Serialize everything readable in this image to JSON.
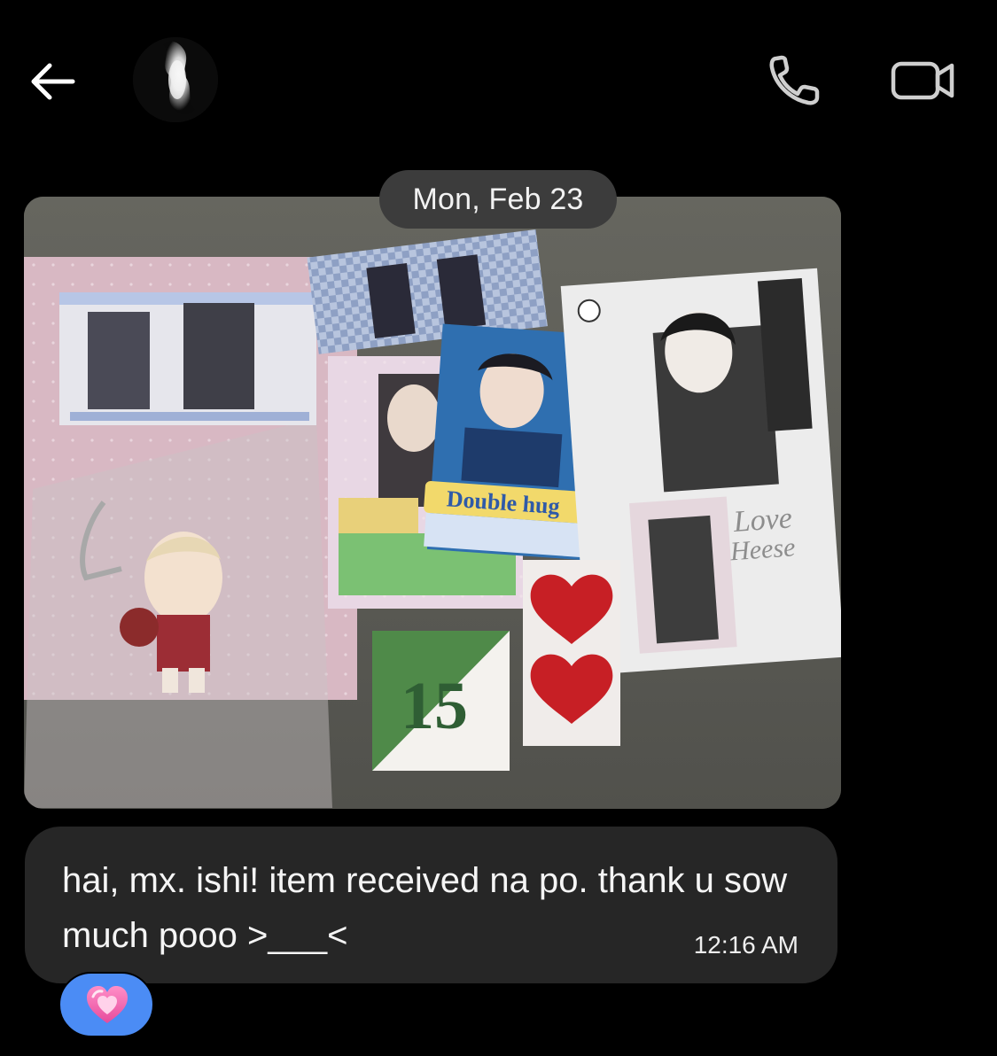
{
  "header": {
    "back_icon": "arrow-left-icon",
    "avatar_icon": "profile-avatar",
    "call_icon": "phone-icon",
    "video_icon": "video-camera-icon"
  },
  "timeline": {
    "date_label": "Mon, Feb 23"
  },
  "attachment": {
    "type": "photo",
    "icon": "photo-attachment"
  },
  "message": {
    "text": "hai, mx. ishi! item received na po. thank u sow much pooo >___<",
    "time": "12:16 AM"
  },
  "reaction": {
    "emoji": "pink-heart-icon",
    "color": "#4b8cf5"
  },
  "colors": {
    "background": "#000000",
    "bubble": "#262626",
    "date_pill": "#3c3c3c"
  }
}
